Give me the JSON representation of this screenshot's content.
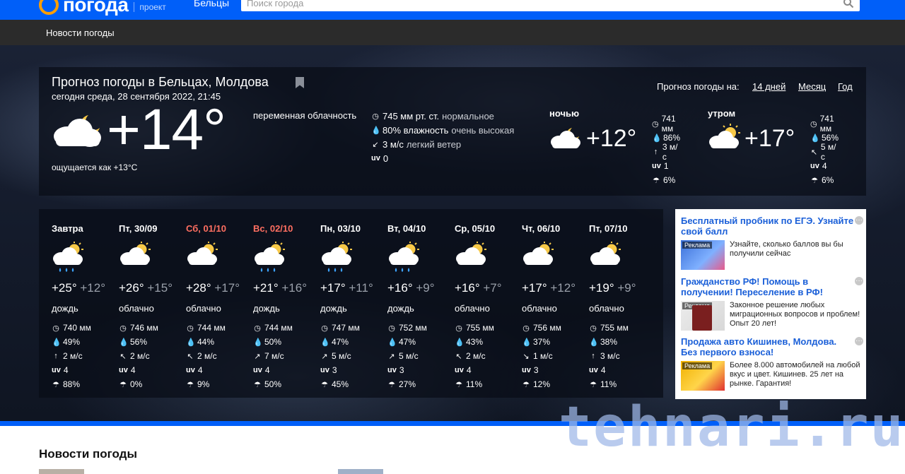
{
  "topbar": {
    "logo_text": "погода",
    "logo_project": "проект",
    "city": "Бельцы",
    "search_placeholder": "Поиск города"
  },
  "nav": {
    "news_link": "Новости погоды"
  },
  "current": {
    "title": "Прогноз погоды в Бельцах, Молдова",
    "date": "сегодня среда, 28 сентября 2022, 21:45",
    "temp": "+14°",
    "feels": "ощущается как +13°C",
    "condition": "переменная облачность",
    "pressure": "745 мм рт. ст.",
    "pressure_note": "нормальное",
    "humidity": "80% влажность",
    "humidity_note": "очень высокая",
    "wind": "3 м/с",
    "wind_note": "легкий ветер",
    "uv_label": "uv",
    "uv": "0"
  },
  "forecast_nav": {
    "label": "Прогноз погоды на:",
    "links": [
      "14 дней",
      "Месяц",
      "Год"
    ]
  },
  "parts": [
    {
      "name": "ночью",
      "temp": "+12°",
      "pressure": "741 мм",
      "humidity": "86%",
      "wind": "3 м/с",
      "uv": "1",
      "precip": "6%"
    },
    {
      "name": "утром",
      "temp": "+17°",
      "pressure": "741 мм",
      "humidity": "56%",
      "wind": "5 м/с",
      "uv": "4",
      "precip": "6%"
    }
  ],
  "days": [
    {
      "name": "Завтра",
      "weekend": false,
      "hi": "+25°",
      "lo": "+12°",
      "cond": "дождь",
      "rain": true,
      "pressure": "740 мм",
      "humidity": "49%",
      "wind": "2 м/с",
      "wind_dir": "↑",
      "uv": "4",
      "precip": "88%"
    },
    {
      "name": "Пт, 30/09",
      "weekend": false,
      "hi": "+26°",
      "lo": "+15°",
      "cond": "облачно",
      "rain": false,
      "pressure": "746 мм",
      "humidity": "56%",
      "wind": "2 м/с",
      "wind_dir": "↖",
      "uv": "4",
      "precip": "0%"
    },
    {
      "name": "Сб, 01/10",
      "weekend": true,
      "hi": "+28°",
      "lo": "+17°",
      "cond": "облачно",
      "rain": false,
      "pressure": "744 мм",
      "humidity": "44%",
      "wind": "2 м/с",
      "wind_dir": "↖",
      "uv": "4",
      "precip": "9%"
    },
    {
      "name": "Вс, 02/10",
      "weekend": true,
      "hi": "+21°",
      "lo": "+16°",
      "cond": "дождь",
      "rain": true,
      "pressure": "744 мм",
      "humidity": "50%",
      "wind": "7 м/с",
      "wind_dir": "↗",
      "uv": "4",
      "precip": "50%"
    },
    {
      "name": "Пн, 03/10",
      "weekend": false,
      "hi": "+17°",
      "lo": "+11°",
      "cond": "дождь",
      "rain": true,
      "pressure": "747 мм",
      "humidity": "47%",
      "wind": "5 м/с",
      "wind_dir": "↗",
      "uv": "3",
      "precip": "45%"
    },
    {
      "name": "Вт, 04/10",
      "weekend": false,
      "hi": "+16°",
      "lo": "+9°",
      "cond": "дождь",
      "rain": true,
      "pressure": "752 мм",
      "humidity": "47%",
      "wind": "5 м/с",
      "wind_dir": "↗",
      "uv": "3",
      "precip": "27%"
    },
    {
      "name": "Ср, 05/10",
      "weekend": false,
      "hi": "+16°",
      "lo": "+7°",
      "cond": "облачно",
      "rain": false,
      "pressure": "755 мм",
      "humidity": "43%",
      "wind": "2 м/с",
      "wind_dir": "↖",
      "uv": "4",
      "precip": "11%"
    },
    {
      "name": "Чт, 06/10",
      "weekend": false,
      "hi": "+17°",
      "lo": "+12°",
      "cond": "облачно",
      "rain": false,
      "pressure": "756 мм",
      "humidity": "37%",
      "wind": "1 м/с",
      "wind_dir": "↘",
      "uv": "3",
      "precip": "12%"
    },
    {
      "name": "Пт, 07/10",
      "weekend": false,
      "hi": "+19°",
      "lo": "+9°",
      "cond": "облачно",
      "rain": false,
      "pressure": "755 мм",
      "humidity": "38%",
      "wind": "3 м/с",
      "wind_dir": "↑",
      "uv": "4",
      "precip": "11%"
    }
  ],
  "ads": [
    {
      "headline": "Бесплатный пробник по ЕГЭ. Узнайте свой балл",
      "tag": "Реклама",
      "text": "Узнайте, сколько баллов вы бы получили сейчас"
    },
    {
      "headline": "Гражданство РФ! Помощь в получении! Переселение в РФ!",
      "tag": "Реклама",
      "text": "Законное решение любых миграционных вопросов и проблем! Опыт 20 лет!"
    },
    {
      "headline": "Продажа авто Кишинев, Молдова. Без первого взноса!",
      "tag": "Реклама",
      "text": "Более 8.000 автомобилей на любой вкус и цвет. Кишинев. 25 лет на рынке. Гарантия!"
    }
  ],
  "news_section": {
    "title": "Новости погоды"
  },
  "watermark": "tehnari.ru",
  "colors": {
    "brand_blue": "#005ff9",
    "logo_orange": "#ff9e00",
    "weekend_red": "#ff6f61",
    "ad_link_blue": "#1a5fd8"
  }
}
